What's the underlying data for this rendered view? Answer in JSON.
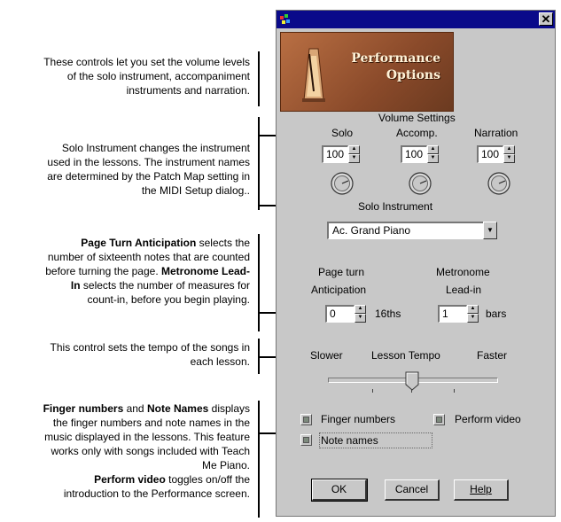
{
  "annotations": {
    "volume": [
      "These controls let you set the volume levels",
      "of the solo instrument, accompaniment",
      "instruments and narration."
    ],
    "solo_instrument": [
      "Solo Instrument changes the instrument",
      "used in the lessons. The instrument names",
      "are determined by the Patch Map setting in",
      "the MIDI Setup dialog.."
    ],
    "page_turn": {
      "l1": "Page Turn Anticipation",
      "l1_rest": " selects the",
      "l2": "number of sixteenth notes that are counted",
      "l3_pre": "before turning the page. ",
      "l3_bold": "Metronome Lead-",
      "l4_bold": "In",
      "l4_rest": " selects the number of measures for",
      "l5": "count-in, before you begin playing."
    },
    "tempo": [
      "This control sets the tempo of the songs in",
      "each lesson."
    ],
    "finger": {
      "l1_b1": "Finger numbers",
      "l1_mid": " and ",
      "l1_b2": "Note Names",
      "l1_rest": " displays",
      "l2": "the finger numbers and note names in the",
      "l3": "music displayed in the lessons. This feature",
      "l4": "works only with songs included with Teach",
      "l5": "Me Piano.",
      "l6_bold": "Perform video",
      "l6_rest": " toggles on/off the",
      "l7": "introduction to the Performance screen."
    }
  },
  "dialog": {
    "close_glyph": "✕",
    "banner_title_1": "Performance",
    "banner_title_2": "Options",
    "volume_settings_label": "Volume Settings",
    "solo_label": "Solo",
    "accomp_label": "Accomp.",
    "narration_label": "Narration",
    "solo_value": "100",
    "accomp_value": "100",
    "narration_value": "100",
    "solo_instrument_label": "Solo Instrument",
    "instrument_selected": "Ac. Grand Piano",
    "page_turn_label_1": "Page turn",
    "page_turn_label_2": "Anticipation",
    "page_turn_value": "0",
    "page_turn_unit": "16ths",
    "metronome_label_1": "Metronome",
    "metronome_label_2": "Lead-in",
    "metronome_value": "1",
    "metronome_unit": "bars",
    "slower_label": "Slower",
    "lesson_tempo_label": "Lesson Tempo",
    "faster_label": "Faster",
    "lesson_tempo_level_fraction": 0.48,
    "finger_numbers_label": "Finger numbers",
    "perform_video_label": "Perform video",
    "note_names_label": "Note names",
    "ok_label": "OK",
    "cancel_label": "Cancel",
    "help_label": "Help"
  },
  "colors": {
    "titlebar": "#0a0a8a",
    "dialog_face": "#c8c8c8",
    "banner": "#9a5a35"
  }
}
